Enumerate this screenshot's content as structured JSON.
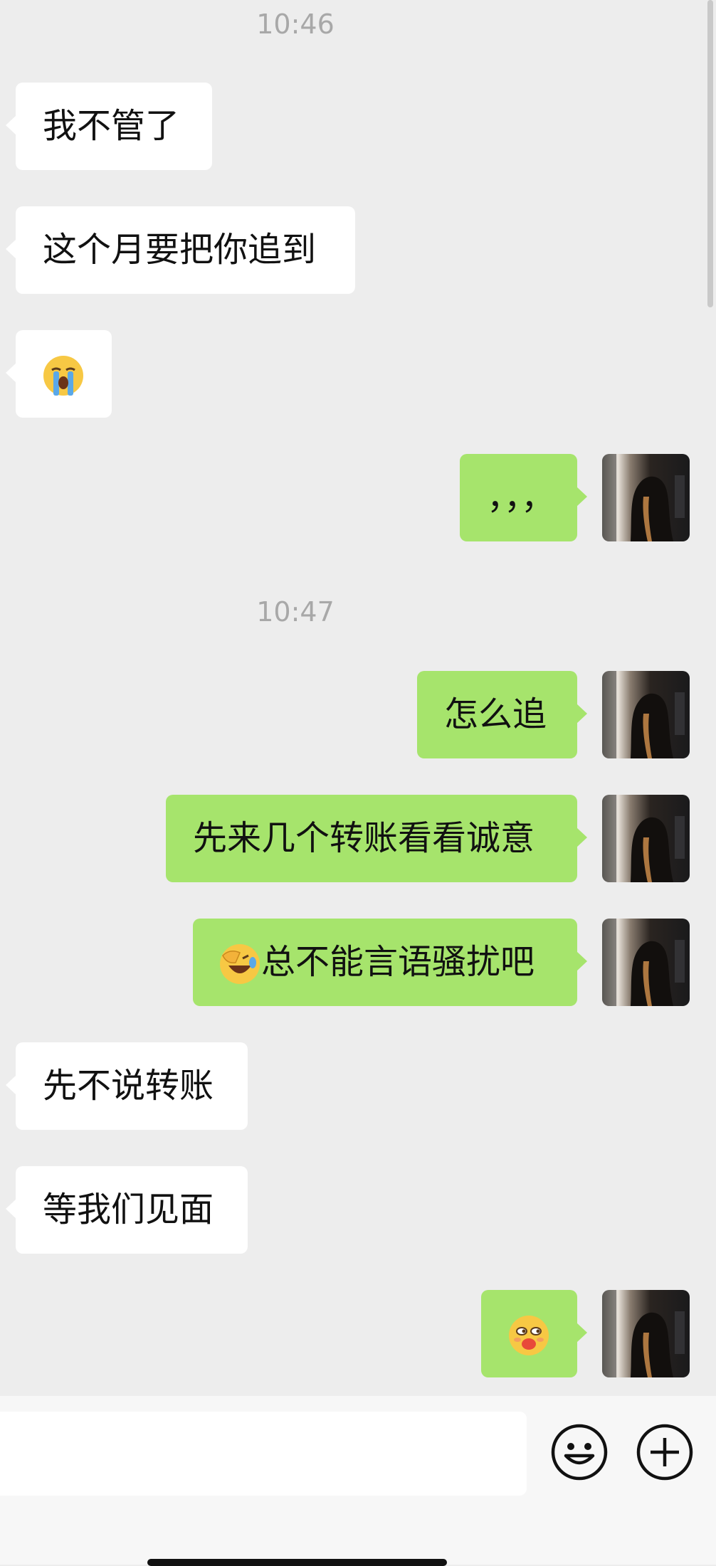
{
  "chat": {
    "timestamps": [
      "10:46",
      "10:47"
    ],
    "messages": [
      {
        "side": "in",
        "text": "我不管了"
      },
      {
        "side": "in",
        "text": "这个月要把你追到"
      },
      {
        "side": "in",
        "text": "",
        "emoji": "loudly-crying-face"
      },
      {
        "side": "out",
        "text": "，，，"
      },
      {
        "side": "out",
        "text": "怎么追"
      },
      {
        "side": "out",
        "text": "先来几个转账看看诚意"
      },
      {
        "side": "out",
        "text": "总不能言语骚扰吧",
        "emoji": "face-palm-laughing"
      },
      {
        "side": "in",
        "text": "先不说转账"
      },
      {
        "side": "in",
        "text": "等我们见面"
      },
      {
        "side": "out",
        "text": "",
        "emoji": "smirk-blushing-face"
      }
    ]
  },
  "input_bar": {
    "icons": [
      "emoji-face-icon",
      "plus-circle-icon"
    ]
  },
  "colors": {
    "background": "#ededed",
    "incoming_bubble": "#ffffff",
    "outgoing_bubble": "#a6e46c",
    "timestamp": "#a8a8a8"
  }
}
